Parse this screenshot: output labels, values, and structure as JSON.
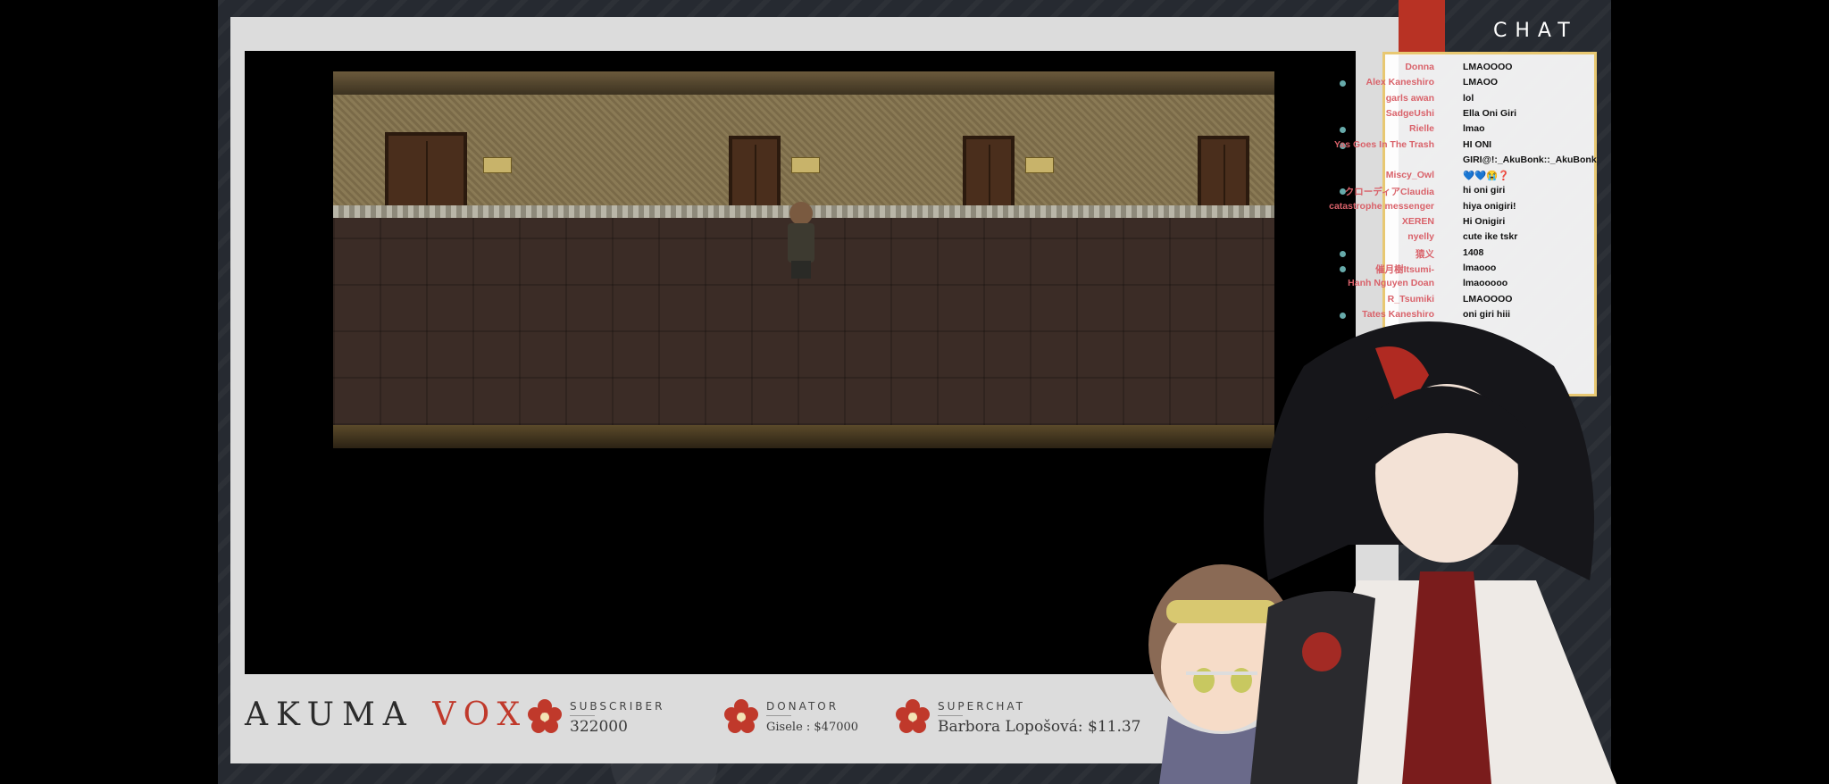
{
  "chat": {
    "title": "CHAT",
    "messages": [
      {
        "name": "Donna",
        "text": "LMAOOOO",
        "badge": false
      },
      {
        "name": "Alex Kaneshiro",
        "text": "LMAOO",
        "badge": true
      },
      {
        "name": "garls awan",
        "text": "lol",
        "badge": false
      },
      {
        "name": "SadgeUshi",
        "text": "Ella Oni Giri",
        "badge": false
      },
      {
        "name": "Rielle",
        "text": "lmao",
        "badge": true
      },
      {
        "name": "Yas Goes In The Trash",
        "text": "HI ONI",
        "badge": true
      },
      {
        "name": "",
        "text": "GIRI@!:_AkuBonk::_AkuBonk",
        "badge": false
      },
      {
        "name": "Miscy_Owl",
        "text": "💙💙😭❓",
        "badge": false
      },
      {
        "name": "クローディアClaudia",
        "text": "hi oni giri",
        "badge": true
      },
      {
        "name": "catastrophe messenger",
        "text": "hiya onigiri!",
        "badge": false
      },
      {
        "name": "XEREN",
        "text": "Hi Onigiri",
        "badge": false
      },
      {
        "name": "nyelly",
        "text": "cute ike tskr",
        "badge": false
      },
      {
        "name": "猿义",
        "text": "1408",
        "badge": true
      },
      {
        "name": "催月樹Itsumi-",
        "text": "lmaooo",
        "badge": true
      },
      {
        "name": "Hanh Nguyen Doan",
        "text": "lmaooooo",
        "badge": false
      },
      {
        "name": "R_Tsumiki",
        "text": "LMAOOOO",
        "badge": false
      },
      {
        "name": "Tates Kaneshiro",
        "text": "oni giri hiii",
        "badge": true
      }
    ]
  },
  "overlay": {
    "brand_main": "AKUMA ",
    "brand_accent": "VOX",
    "subscriber_label": "SUBSCRIBER",
    "subscriber_value": "322000",
    "donator_label": "DONATOR",
    "donator_value": "Gisele : $47000",
    "superchat_label": "SUPERCHAT",
    "superchat_value": "Barbora Lopošová: $11.37"
  },
  "colors": {
    "accent_red": "#c0392b",
    "chat_name": "#d9626a",
    "chat_border": "#e8c872"
  }
}
